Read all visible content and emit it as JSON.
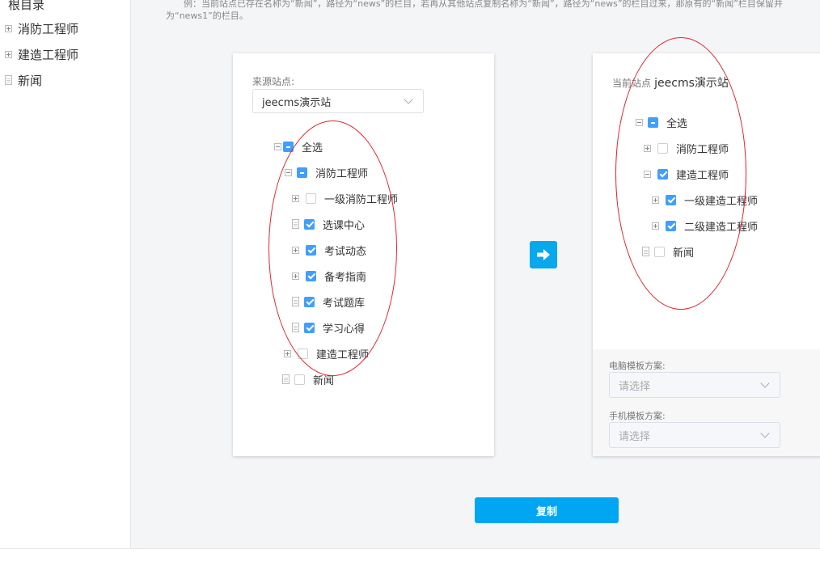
{
  "sidebar": {
    "root_label": "根目录",
    "items": [
      {
        "label": "消防工程师",
        "type": "folder"
      },
      {
        "label": "建造工程师",
        "type": "folder"
      },
      {
        "label": "新闻",
        "type": "doc"
      }
    ]
  },
  "notice": {
    "line1": "例：当前站点已存在名称为“新闻”，路径为“news”的栏目，若再从其他站点复制名称为“新闻”，路径为“news”的栏目过来，那原有的“新闻”栏目保留并",
    "line2": "为“news1”的栏目。"
  },
  "source": {
    "label": "来源站点:",
    "selected_site": "jeecms演示站",
    "tree": [
      {
        "label": "全选",
        "state": "indeterminate",
        "toggle": "minus"
      },
      {
        "label": "消防工程师",
        "state": "indeterminate",
        "toggle": "minus"
      },
      {
        "label": "一级消防工程师",
        "state": "unchecked",
        "toggle": "plus"
      },
      {
        "label": "选课中心",
        "state": "checked",
        "toggle": "doc"
      },
      {
        "label": "考试动态",
        "state": "checked",
        "toggle": "plus"
      },
      {
        "label": "备考指南",
        "state": "checked",
        "toggle": "plus"
      },
      {
        "label": "考试题库",
        "state": "checked",
        "toggle": "doc"
      },
      {
        "label": "学习心得",
        "state": "checked",
        "toggle": "doc"
      },
      {
        "label": "建造工程师",
        "state": "unchecked",
        "toggle": "plus"
      },
      {
        "label": "新闻",
        "state": "unchecked",
        "toggle": "doc"
      }
    ]
  },
  "target": {
    "label": "当前站点",
    "site_name": "jeecms演示站",
    "tree": [
      {
        "label": "全选",
        "state": "indeterminate",
        "toggle": "minus"
      },
      {
        "label": "消防工程师",
        "state": "unchecked",
        "toggle": "plus"
      },
      {
        "label": "建造工程师",
        "state": "checked",
        "toggle": "minus"
      },
      {
        "label": "一级建造工程师",
        "state": "checked",
        "toggle": "plus"
      },
      {
        "label": "二级建造工程师",
        "state": "checked",
        "toggle": "plus"
      },
      {
        "label": "新闻",
        "state": "unchecked",
        "toggle": "doc"
      }
    ],
    "pc_template_label": "电脑模板方案:",
    "pc_template_placeholder": "请选择",
    "mobile_template_label": "手机模板方案:",
    "mobile_template_placeholder": "请选择"
  },
  "actions": {
    "transfer_icon": "arrow-right-icon",
    "copy_label": "复制"
  },
  "colors": {
    "primary": "#00a6f2",
    "checkbox": "#409eff",
    "annotation": "#e3262e"
  }
}
